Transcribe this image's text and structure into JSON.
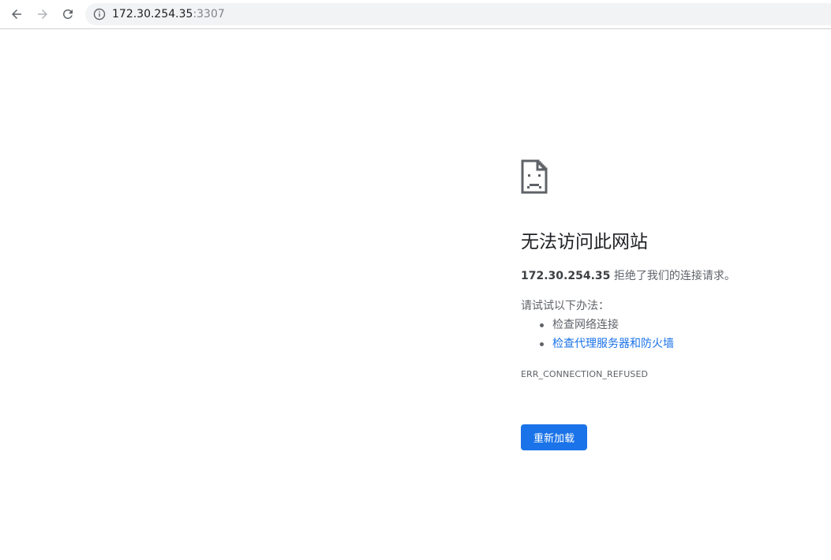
{
  "browser": {
    "url_host": "172.30.254.35",
    "url_port": ":3307",
    "icons": {
      "back": "arrow-left-icon",
      "forward": "arrow-right-icon",
      "reload": "reload-icon",
      "site_info": "info-circle-icon"
    }
  },
  "error_page": {
    "icon": "sad-document-icon",
    "title": "无法访问此网站",
    "host": "172.30.254.35",
    "message": " 拒绝了我们的连接请求。",
    "suggestions_heading": "请试试以下办法：",
    "suggestions": [
      {
        "label": "检查网络连接",
        "link": false
      },
      {
        "label": "检查代理服务器和防火墙",
        "link": true
      }
    ],
    "error_code": "ERR_CONNECTION_REFUSED",
    "reload_button": "重新加载"
  },
  "colors": {
    "accent": "#1a73e8",
    "text_primary": "#202124",
    "text_secondary": "#5f6368",
    "omnibox_bg": "#f1f3f4"
  }
}
